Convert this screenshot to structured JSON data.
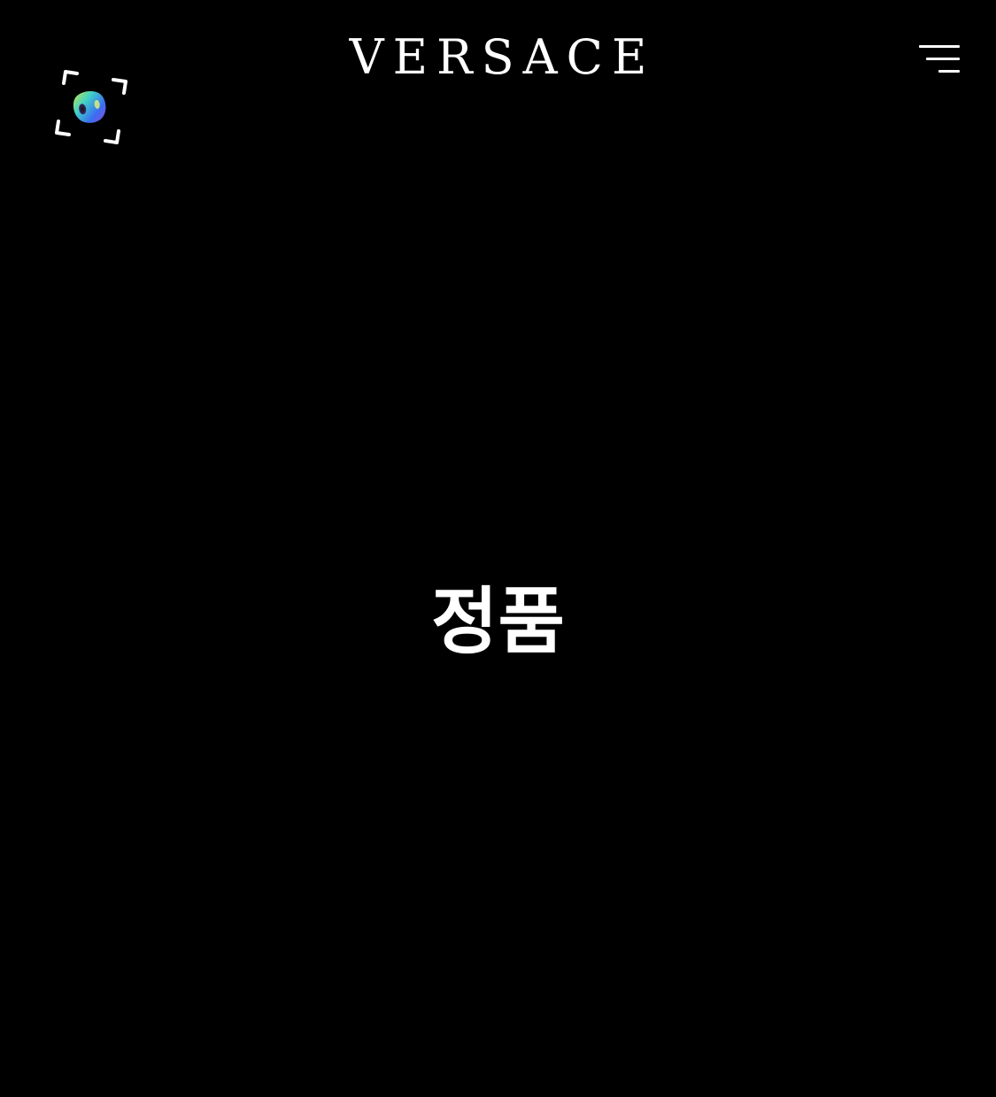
{
  "header": {
    "brand": "VERSACE",
    "scan_button_icon": "scan-3d-icon",
    "menu_icon": "menu-icon"
  },
  "main": {
    "title": "정품"
  },
  "colors": {
    "background": "#000000",
    "foreground": "#ffffff",
    "icon_gradient": [
      "#3b6cf2",
      "#8a4fd6",
      "#3fd0c8",
      "#c7e84a"
    ]
  }
}
